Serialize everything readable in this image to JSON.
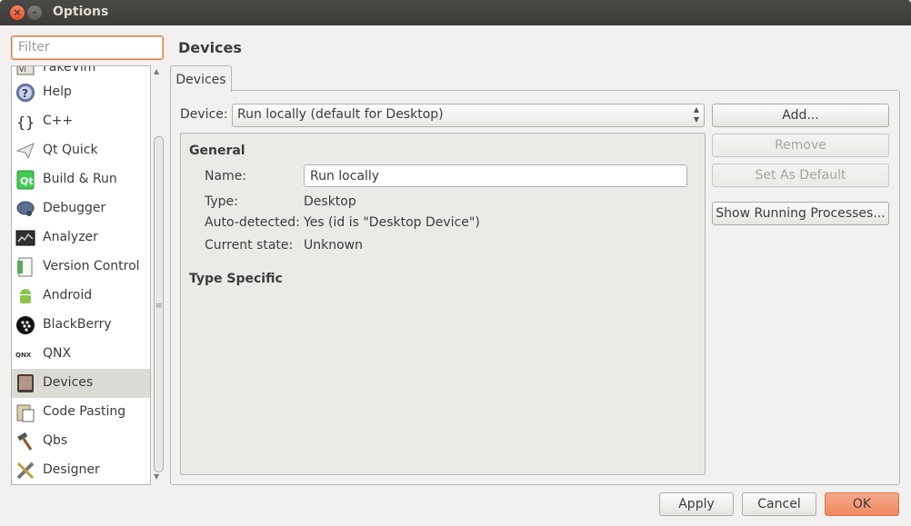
{
  "window": {
    "title": "Options"
  },
  "filter": {
    "placeholder": "Filter",
    "value": ""
  },
  "categories": [
    {
      "label": "FakeVim",
      "icon": "fakevim-icon"
    },
    {
      "label": "Help",
      "icon": "help-icon"
    },
    {
      "label": "C++",
      "icon": "cpp-icon"
    },
    {
      "label": "Qt Quick",
      "icon": "qt-quick-icon"
    },
    {
      "label": "Build & Run",
      "icon": "build-run-icon"
    },
    {
      "label": "Debugger",
      "icon": "debugger-icon"
    },
    {
      "label": "Analyzer",
      "icon": "analyzer-icon"
    },
    {
      "label": "Version Control",
      "icon": "version-control-icon"
    },
    {
      "label": "Android",
      "icon": "android-icon"
    },
    {
      "label": "BlackBerry",
      "icon": "blackberry-icon"
    },
    {
      "label": "QNX",
      "icon": "qnx-icon"
    },
    {
      "label": "Devices",
      "icon": "devices-icon",
      "selected": true
    },
    {
      "label": "Code Pasting",
      "icon": "code-pasting-icon"
    },
    {
      "label": "Qbs",
      "icon": "qbs-icon"
    },
    {
      "label": "Designer",
      "icon": "designer-icon"
    }
  ],
  "page": {
    "title": "Devices",
    "tab": "Devices"
  },
  "device": {
    "label": "Device:",
    "selected": "Run locally (default for Desktop)"
  },
  "general": {
    "heading": "General",
    "name_label": "Name:",
    "name_value": "Run locally",
    "type_label": "Type:",
    "type_value": "Desktop",
    "autodetected_label": "Auto-detected:",
    "autodetected_value": "Yes (id is \"Desktop Device\")",
    "state_label": "Current state:",
    "state_value": "Unknown"
  },
  "type_specific": {
    "heading": "Type Specific"
  },
  "side_buttons": {
    "add": "Add...",
    "remove": "Remove",
    "set_default": "Set As Default",
    "show_processes": "Show Running Processes..."
  },
  "footer": {
    "apply": "Apply",
    "cancel": "Cancel",
    "ok": "OK"
  }
}
